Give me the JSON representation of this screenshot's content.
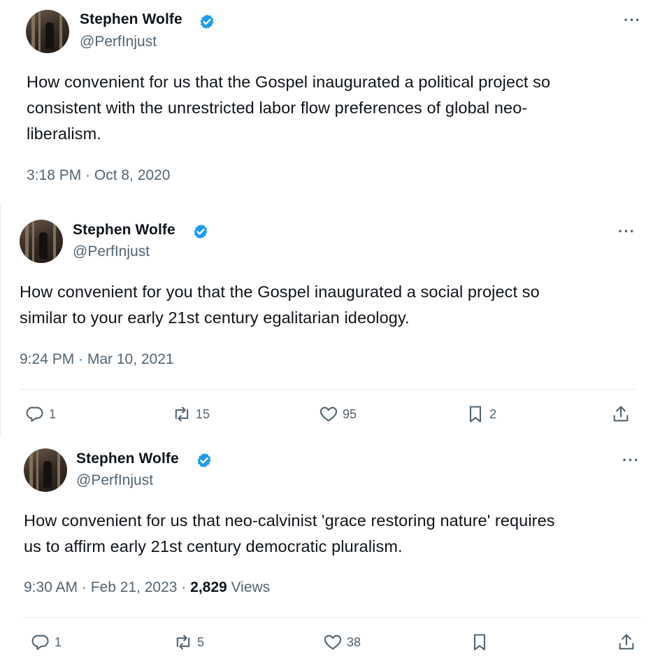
{
  "tweets": [
    {
      "author_name": "Stephen Wolfe",
      "author_handle": "@PerfInjust",
      "text_lines": [
        "How convenient for us that the Gospel inaugurated a political project so",
        "consistent with the unrestricted labor flow preferences of global neo-",
        "liberalism."
      ],
      "timestamp": "3:18 PM · Oct 8, 2020",
      "more": "···"
    },
    {
      "author_name": "Stephen Wolfe",
      "author_handle": "@PerfInjust",
      "text_lines": [
        "How convenient for you that the Gospel inaugurated a social project so",
        "similar to your early 21st century egalitarian ideology."
      ],
      "timestamp": "9:24 PM · Mar 10, 2021",
      "more": "···",
      "actions": {
        "replies": "1",
        "reposts": "15",
        "likes": "95",
        "bookmarks": "2"
      }
    },
    {
      "author_name": "Stephen Wolfe",
      "author_handle": "@PerfInjust",
      "text_lines": [
        "How convenient for us that neo-calvinist 'grace restoring nature' requires",
        "us to affirm early 21st century democratic pluralism."
      ],
      "timestamp": "9:30 AM · Feb 21, 2023 · ",
      "views_count": "2,829",
      "views_label": " Views",
      "more": "···",
      "actions": {
        "replies": "1",
        "reposts": "5",
        "likes": "38",
        "bookmarks": ""
      }
    }
  ],
  "icons": {
    "verified": "verified-badge-icon",
    "reply": "reply-icon",
    "repost": "repost-icon",
    "like": "heart-icon",
    "bookmark": "bookmark-icon",
    "share": "share-icon",
    "more": "more-options-icon"
  },
  "colors": {
    "verified": "#1d9bf0",
    "text": "#0f1419",
    "secondary": "#536471",
    "divider": "#e6ecf0"
  }
}
